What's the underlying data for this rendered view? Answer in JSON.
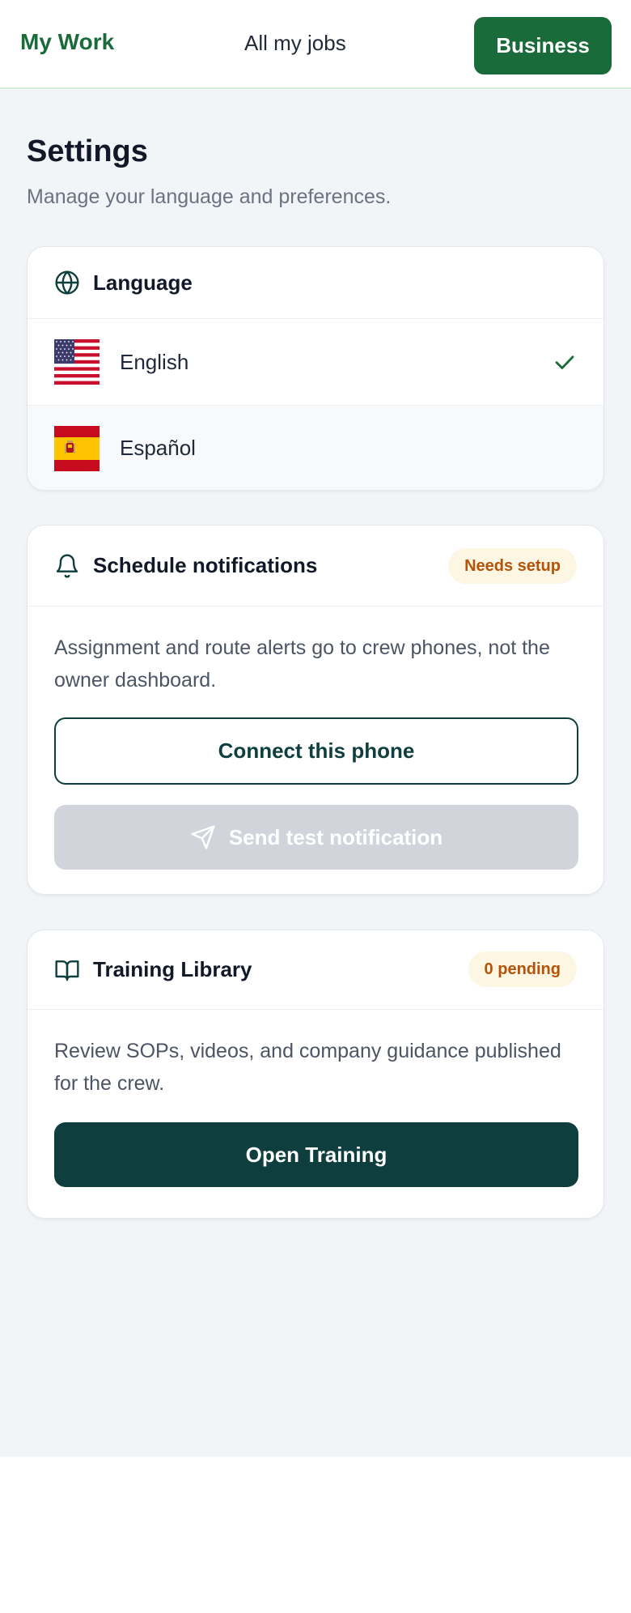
{
  "header": {
    "brand": "My Work",
    "nav_link": "All my jobs",
    "business_button": "Business"
  },
  "page": {
    "title": "Settings",
    "subtitle": "Manage your language and preferences."
  },
  "language_card": {
    "title": "Language",
    "icon": "globe-icon",
    "options": [
      {
        "label": "English",
        "flag": "us-flag-icon",
        "selected": true
      },
      {
        "label": "Español",
        "flag": "spain-flag-icon",
        "selected": false
      }
    ]
  },
  "notifications_card": {
    "title": "Schedule notifications",
    "icon": "bell-icon",
    "badge": "Needs setup",
    "description": "Assignment and route alerts go to crew phones, not the owner dashboard.",
    "connect_button": "Connect this phone",
    "test_button": "Send test notification",
    "test_button_disabled": true
  },
  "training_card": {
    "title": "Training Library",
    "icon": "book-icon",
    "badge": "0 pending",
    "description": "Review SOPs, videos, and company guidance published for the crew.",
    "open_button": "Open Training"
  },
  "colors": {
    "brand_green": "#1a6b3a",
    "dark_teal": "#0e3e3d",
    "badge_bg": "#fdf6e3",
    "badge_text": "#b45309",
    "background": "#f2f5f8",
    "disabled": "#d1d5db"
  }
}
